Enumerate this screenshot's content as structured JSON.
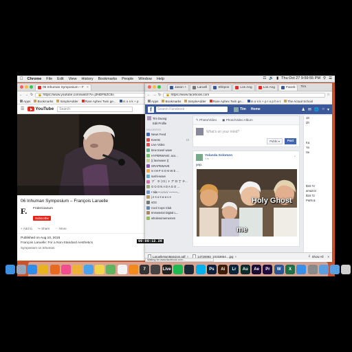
{
  "menubar": {
    "app": "Chrome",
    "items": [
      "File",
      "Edit",
      "View",
      "History",
      "Bookmarks",
      "People",
      "Window",
      "Help"
    ],
    "datetime": "Thu Oct 27 9:59:55 PM"
  },
  "yt_window": {
    "tabs": [
      {
        "title": "06 Inhuman Symposium – F",
        "active": true,
        "fav": "#e52d27"
      }
    ],
    "url": "https://www.youtube.com/watch?v=j3NDFBZCtlo",
    "bookmarks": [
      "Apps",
      "Bookmarks",
      "SimpleAdder",
      "Rare Aphex Twin ge...",
      "m o n k + p"
    ],
    "logo_text": "YouTube",
    "search_placeholder": "Search",
    "video_title": "06 Inhuman Symposium – François Laruelle",
    "channel_logo": "F.",
    "channel_name": "Fridericianum",
    "subscribe": "Subscribe",
    "actions": [
      "+ Add to",
      "↪ Share",
      "··· More"
    ],
    "published": "Published on Aug 10, 2015",
    "description": "François Laruelle: For a Non-Standard Aesthetics",
    "more_text": "Symposium on Inhuman",
    "timestamp": "00:00:12.26"
  },
  "fb_window": {
    "tabs": [
      {
        "title": "Jason +",
        "fav": "#3b5998",
        "active": false
      },
      {
        "title": "Laruell",
        "fav": "#777",
        "active": false
      },
      {
        "title": "Shitpos",
        "fav": "#3b5998",
        "active": false
      },
      {
        "title": "Los Ang",
        "fav": "#e52d27",
        "active": false
      },
      {
        "title": "Los Ang",
        "fav": "#e52d27",
        "active": false
      },
      {
        "title": "Faceb",
        "fav": "#3b5998",
        "active": true
      },
      {
        "title": "Tim",
        "fav": "#bbb",
        "active": false
      }
    ],
    "url": "https://www.facebook.com",
    "bookmarks": [
      "Apps",
      "Bookmarks",
      "SimpleAdder",
      "Rare Aphex Twin ge...",
      "m o n k + p r o p h e t",
      "The Actual School"
    ],
    "search_placeholder": "Search Facebook",
    "user": "Tim",
    "home": "Home",
    "left": {
      "profile": "Tim Duong",
      "edit": "Edit Profile",
      "favorites_header": "FAVORITES",
      "items": [
        {
          "label": "News Feed",
          "count": "",
          "color": "#4267b2"
        },
        {
          "label": "Events",
          "count": "19",
          "color": "#e34c4c"
        },
        {
          "label": "Live Video",
          "count": "",
          "color": "#e34c4c"
        },
        {
          "label": "time travel wave",
          "count": "",
          "color": "#6a8"
        },
        {
          "label": "HYPERWAVE: aco...",
          "count": "",
          "color": "#7b6"
        },
        {
          "label": ")( lacewave )(",
          "count": "",
          "color": "#cc9"
        },
        {
          "label": "GRAPEWAVE",
          "count": "",
          "color": "#85a"
        },
        {
          "label": "S I M P S O N W E ...",
          "count": "",
          "color": "#ea5"
        },
        {
          "label": "sushi-wave",
          "count": "",
          "color": "#6ac"
        },
        {
          "label": "フ゛ラ | ロ | ト ア ロ 丁 テ...",
          "count": "",
          "color": "#c7a"
        },
        {
          "label": "G O O N A D A G O ...",
          "count": "",
          "color": "#9a7"
        },
        {
          "label": "• tide • √√√√√ ~~~~~...",
          "count": "",
          "color": "#79c"
        },
        {
          "label": "j e s u s w a v e",
          "count": "",
          "color": "#b96"
        },
        {
          "label": "sO3",
          "count": "",
          "color": "#777"
        },
        {
          "label": "Cool Cops Club",
          "count": "",
          "color": "#68a"
        },
        {
          "label": "Immaterial Digital L...",
          "count": "",
          "color": "#a86"
        },
        {
          "label": "wholesomememes",
          "count": "",
          "color": "#9b6"
        }
      ]
    },
    "composer": {
      "tabs": [
        "✎ Photo/Video",
        "▣ Photo/Video Album"
      ],
      "prompt": "What's on your mind?",
      "privacy": "Public ▾",
      "post": "Post"
    },
    "story": {
      "author": "Yolanda Solomon",
      "time": "1 hr · ◌",
      "text": "yep.",
      "gif_caption_1": "Holy Ghost",
      "gif_caption_2": "me"
    },
    "right": [
      "18",
      "Zh",
      "",
      "Ka",
      "Ya",
      "Se",
      "",
      "$18.72",
      "amazon",
      "$18.72",
      "Parts &"
    ],
    "status_text": "Waiting for www.facebook.com...",
    "downloads": [
      "LaruelleNonMarxism.pdf",
      "14720093_10153654....jpg"
    ],
    "show_all": "Show All"
  },
  "dock": [
    "finder",
    "launchpad",
    "safari",
    "chrome",
    "firefox",
    "itunes",
    "photos",
    "mail",
    "notes",
    "maps",
    "calendar",
    "vlc",
    "7",
    "unity",
    "live",
    "spotify",
    "steam",
    "skype",
    "photoshop",
    "illustrator",
    "lightroom",
    "audition",
    "aftereffects",
    "premiere",
    "word",
    "excel",
    "app-store",
    "prefs",
    "folder",
    "downloads",
    "trash"
  ]
}
